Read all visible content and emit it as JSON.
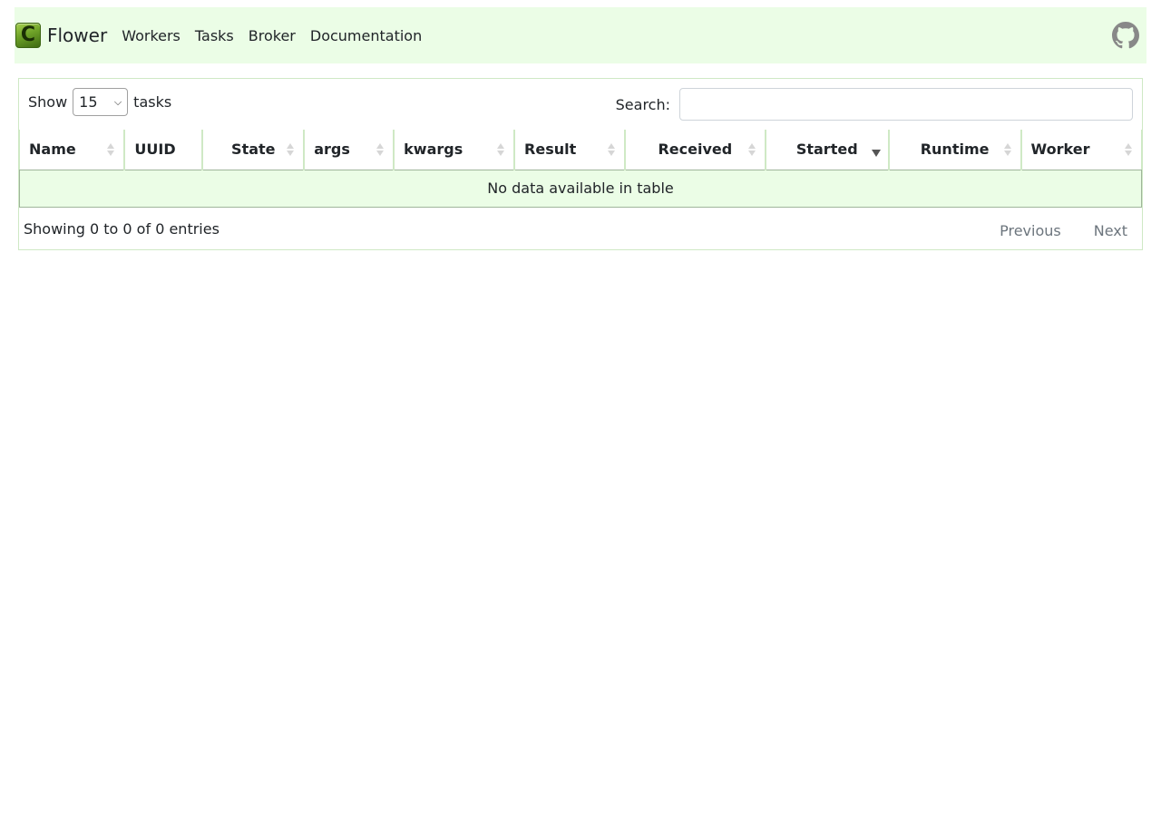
{
  "navbar": {
    "brand": "Flower",
    "logo_letter": "C",
    "links": [
      "Workers",
      "Tasks",
      "Broker",
      "Documentation"
    ],
    "github_icon": "github-icon"
  },
  "controls": {
    "show_label": "Show",
    "page_length": "15",
    "tasks_label": "tasks",
    "search_label": "Search:",
    "search_value": ""
  },
  "table": {
    "columns": [
      "Name",
      "UUID",
      "State",
      "args",
      "kwargs",
      "Result",
      "Received",
      "Started",
      "Runtime",
      "Worker"
    ],
    "sorted_column": "Started",
    "empty_message": "No data available in table"
  },
  "footer": {
    "info": "Showing 0 to 0 of 0 entries",
    "previous": "Previous",
    "next": "Next"
  },
  "colors": {
    "navbar_bg": "#ebfde6",
    "border": "#cfe9c5"
  }
}
